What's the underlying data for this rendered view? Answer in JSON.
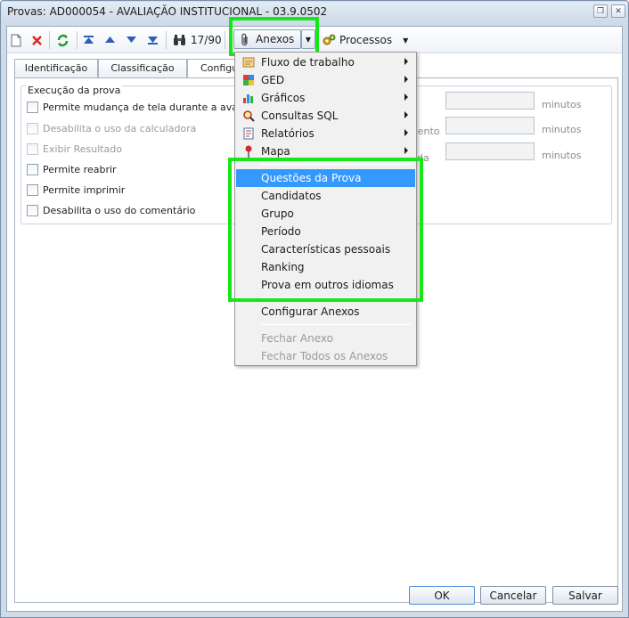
{
  "window": {
    "title": "Provas: AD000054 - AVALIAÇÃO INSTITUCIONAL - 03.9.0502",
    "controls": {
      "restore_icon": "restore-icon",
      "close_icon": "close-icon"
    }
  },
  "toolbar": {
    "icons": [
      "new-document-icon",
      "delete-icon",
      "refresh-icon",
      "first-record-icon",
      "previous-record-icon",
      "next-record-icon",
      "last-record-icon",
      "binoculars-icon"
    ],
    "record_counter": "17/90",
    "anexos_label": "Anexos",
    "processos_label": "Processos"
  },
  "tabs": [
    {
      "label": "Identificação"
    },
    {
      "label": "Classificação"
    },
    {
      "label": "Configu"
    }
  ],
  "group": {
    "legend": "Execução da prova",
    "checkboxes": [
      {
        "label": "Permite mudança de tela durante a avaliação",
        "checked": false,
        "enabled": true
      },
      {
        "label": "Desabilita o uso da calculadora",
        "checked": false,
        "enabled": false
      },
      {
        "label": "Exibir Resultado",
        "checked": false,
        "enabled": false
      },
      {
        "label": "Permite reabrir",
        "checked": false,
        "enabled": true
      },
      {
        "label": "Permite imprimir",
        "checked": false,
        "enabled": true
      },
      {
        "label": "Desabilita o uso do comentário",
        "checked": false,
        "enabled": true
      }
    ],
    "time_fields": [
      {
        "label_fragment": "",
        "value": "",
        "unit": "minutos"
      },
      {
        "label_fragment": "mento",
        "value": "",
        "unit": "minutos"
      },
      {
        "label_fragment": "da",
        "value": "",
        "unit": "minutos"
      }
    ]
  },
  "menu": {
    "submenus": [
      {
        "label": "Fluxo de trabalho",
        "icon": "workflow-icon"
      },
      {
        "label": "GED",
        "icon": "ged-icon"
      },
      {
        "label": "Gráficos",
        "icon": "chart-icon"
      },
      {
        "label": "Consultas SQL",
        "icon": "sql-query-icon"
      },
      {
        "label": "Relatórios",
        "icon": "report-icon"
      },
      {
        "label": "Mapa",
        "icon": "map-pin-icon"
      }
    ],
    "attachments": [
      {
        "label": "Questões da Prova",
        "selected": true
      },
      {
        "label": "Candidatos"
      },
      {
        "label": "Grupo"
      },
      {
        "label": "Período"
      },
      {
        "label": "Características pessoais"
      },
      {
        "label": "Ranking"
      },
      {
        "label": "Prova em outros idiomas"
      }
    ],
    "configure": "Configurar Anexos",
    "close_one": "Fechar Anexo",
    "close_all": "Fechar Todos os Anexos"
  },
  "footer": {
    "ok": "OK",
    "cancel": "Cancelar",
    "save": "Salvar"
  },
  "colors": {
    "highlight_box": "#19e619",
    "menu_selection": "#3399ff",
    "window_frame": "#cfdbe8"
  }
}
